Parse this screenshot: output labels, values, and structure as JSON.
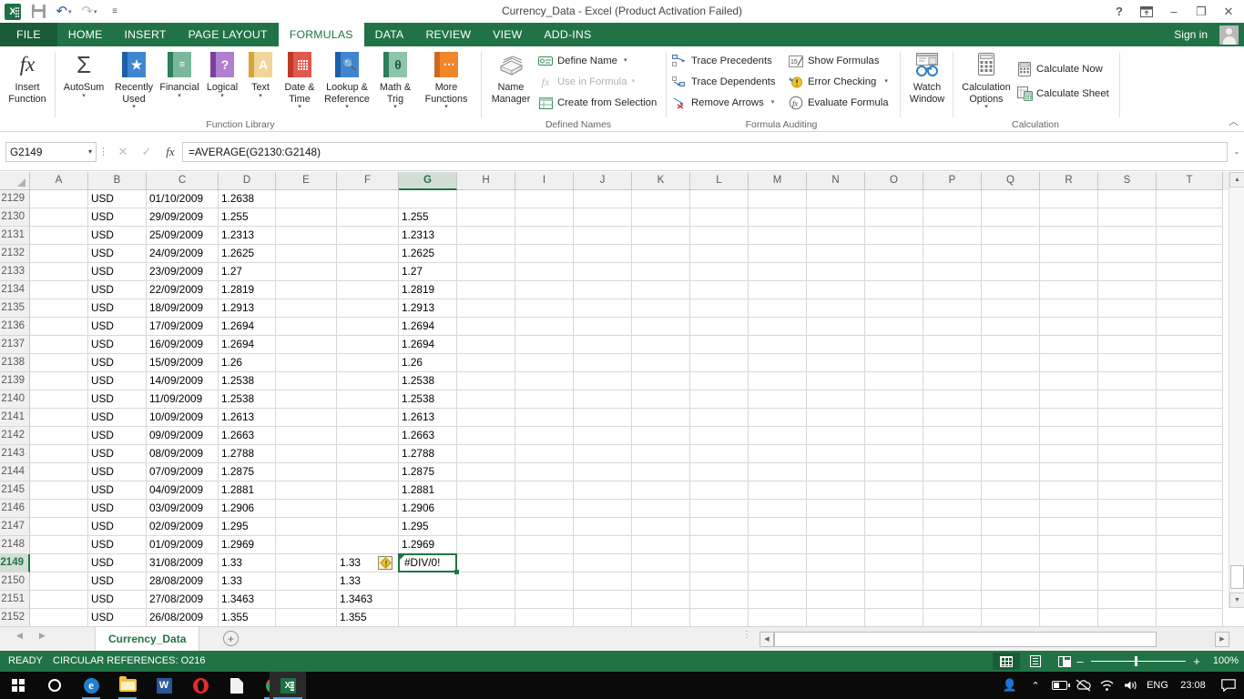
{
  "window": {
    "title": "Currency_Data - Excel (Product Activation Failed)",
    "quick_access": [
      {
        "name": "excel-logo",
        "label": "X"
      },
      {
        "name": "save-icon",
        "label": "Save"
      },
      {
        "name": "undo-icon",
        "label": "↶"
      },
      {
        "name": "redo-icon",
        "label": "↷"
      },
      {
        "name": "customize-qat-icon",
        "label": "⌄"
      }
    ],
    "controls": {
      "help": "?",
      "ribbon_display": "ribbon-display-options",
      "minimize": "–",
      "restore": "❐",
      "close": "✕"
    },
    "signin": "Sign in"
  },
  "ribbon": {
    "tabs": [
      {
        "label": "FILE",
        "active": false,
        "file": true
      },
      {
        "label": "HOME",
        "active": false
      },
      {
        "label": "INSERT",
        "active": false
      },
      {
        "label": "PAGE LAYOUT",
        "active": false
      },
      {
        "label": "FORMULAS",
        "active": true
      },
      {
        "label": "DATA",
        "active": false
      },
      {
        "label": "REVIEW",
        "active": false
      },
      {
        "label": "VIEW",
        "active": false
      },
      {
        "label": "ADD-INS",
        "active": false
      }
    ],
    "groups": [
      {
        "name": "function-library",
        "label": "Function Library",
        "buttons": [
          {
            "label": "Insert\nFunction",
            "icon": "fx-icon",
            "dropdown": false
          },
          {
            "label": "AutoSum",
            "icon": "sigma-icon",
            "dropdown": true
          },
          {
            "label": "Recently\nUsed",
            "icon": "star-book-icon",
            "dropdown": true
          },
          {
            "label": "Financial",
            "icon": "coins-book-icon",
            "dropdown": true
          },
          {
            "label": "Logical",
            "icon": "question-book-icon",
            "dropdown": true
          },
          {
            "label": "Text",
            "icon": "letter-a-book-icon",
            "dropdown": true
          },
          {
            "label": "Date &\nTime",
            "icon": "calendar-book-icon",
            "dropdown": true
          },
          {
            "label": "Lookup &\nReference",
            "icon": "magnifier-book-icon",
            "dropdown": true
          },
          {
            "label": "Math &\nTrig",
            "icon": "theta-book-icon",
            "dropdown": true
          },
          {
            "label": "More\nFunctions",
            "icon": "ellipsis-book-icon",
            "dropdown": true
          }
        ]
      },
      {
        "name": "defined-names",
        "label": "Defined Names",
        "big": {
          "label": "Name\nManager",
          "icon": "name-manager-icon"
        },
        "commands": [
          {
            "label": "Define Name",
            "icon": "define-name-icon",
            "dropdown": true,
            "disabled": false
          },
          {
            "label": "Use in Formula",
            "icon": "use-in-formula-icon",
            "dropdown": true,
            "disabled": true
          },
          {
            "label": "Create from Selection",
            "icon": "create-from-selection-icon",
            "dropdown": false,
            "disabled": false
          }
        ]
      },
      {
        "name": "formula-auditing",
        "label": "Formula Auditing",
        "col1": [
          {
            "label": "Trace Precedents",
            "icon": "trace-precedents-icon",
            "dropdown": false
          },
          {
            "label": "Trace Dependents",
            "icon": "trace-dependents-icon",
            "dropdown": false
          },
          {
            "label": "Remove Arrows",
            "icon": "remove-arrows-icon",
            "dropdown": true
          }
        ],
        "col2": [
          {
            "label": "Show Formulas",
            "icon": "show-formulas-icon",
            "dropdown": false
          },
          {
            "label": "Error Checking",
            "icon": "error-checking-icon",
            "dropdown": true
          },
          {
            "label": "Evaluate Formula",
            "icon": "evaluate-formula-icon",
            "dropdown": false
          }
        ],
        "watch": {
          "label": "Watch\nWindow",
          "icon": "watch-window-icon"
        }
      },
      {
        "name": "calculation",
        "label": "Calculation",
        "big": {
          "label": "Calculation\nOptions",
          "icon": "calculation-options-icon",
          "dropdown": true
        },
        "commands": [
          {
            "label": "Calculate Now",
            "icon": "calculate-now-icon"
          },
          {
            "label": "Calculate Sheet",
            "icon": "calculate-sheet-icon"
          }
        ]
      }
    ],
    "collapse": "collapse-ribbon-icon"
  },
  "formula_bar": {
    "name_box": "G2149",
    "cancel": "✕",
    "enter": "✓",
    "fx": "fx",
    "formula": "=AVERAGE(G2130:G2148)",
    "expand": "⌄"
  },
  "grid": {
    "columns": [
      "A",
      "B",
      "C",
      "D",
      "E",
      "F",
      "G",
      "H",
      "I",
      "J",
      "K",
      "L",
      "M",
      "N",
      "O",
      "P",
      "Q",
      "R",
      "S",
      "T"
    ],
    "selected_column": "G",
    "selected_row": "2149",
    "selected_cell": "G2149",
    "selected_value": "#DIV/0!",
    "rows": [
      {
        "n": "2129",
        "b": "USD",
        "c": "01/10/2009",
        "d": "1.2638",
        "f": "",
        "g": ""
      },
      {
        "n": "2130",
        "b": "USD",
        "c": "29/09/2009",
        "d": "1.255",
        "f": "",
        "g": "1.255"
      },
      {
        "n": "2131",
        "b": "USD",
        "c": "25/09/2009",
        "d": "1.2313",
        "f": "",
        "g": "1.2313"
      },
      {
        "n": "2132",
        "b": "USD",
        "c": "24/09/2009",
        "d": "1.2625",
        "f": "",
        "g": "1.2625"
      },
      {
        "n": "2133",
        "b": "USD",
        "c": "23/09/2009",
        "d": "1.27",
        "f": "",
        "g": "1.27"
      },
      {
        "n": "2134",
        "b": "USD",
        "c": "22/09/2009",
        "d": "1.2819",
        "f": "",
        "g": "1.2819"
      },
      {
        "n": "2135",
        "b": "USD",
        "c": "18/09/2009",
        "d": "1.2913",
        "f": "",
        "g": "1.2913"
      },
      {
        "n": "2136",
        "b": "USD",
        "c": "17/09/2009",
        "d": "1.2694",
        "f": "",
        "g": "1.2694"
      },
      {
        "n": "2137",
        "b": "USD",
        "c": "16/09/2009",
        "d": "1.2694",
        "f": "",
        "g": "1.2694"
      },
      {
        "n": "2138",
        "b": "USD",
        "c": "15/09/2009",
        "d": "1.26",
        "f": "",
        "g": "1.26"
      },
      {
        "n": "2139",
        "b": "USD",
        "c": "14/09/2009",
        "d": "1.2538",
        "f": "",
        "g": "1.2538"
      },
      {
        "n": "2140",
        "b": "USD",
        "c": "11/09/2009",
        "d": "1.2538",
        "f": "",
        "g": "1.2538"
      },
      {
        "n": "2141",
        "b": "USD",
        "c": "10/09/2009",
        "d": "1.2613",
        "f": "",
        "g": "1.2613"
      },
      {
        "n": "2142",
        "b": "USD",
        "c": "09/09/2009",
        "d": "1.2663",
        "f": "",
        "g": "1.2663"
      },
      {
        "n": "2143",
        "b": "USD",
        "c": "08/09/2009",
        "d": "1.2788",
        "f": "",
        "g": "1.2788"
      },
      {
        "n": "2144",
        "b": "USD",
        "c": "07/09/2009",
        "d": "1.2875",
        "f": "",
        "g": "1.2875"
      },
      {
        "n": "2145",
        "b": "USD",
        "c": "04/09/2009",
        "d": "1.2881",
        "f": "",
        "g": "1.2881"
      },
      {
        "n": "2146",
        "b": "USD",
        "c": "03/09/2009",
        "d": "1.2906",
        "f": "",
        "g": "1.2906"
      },
      {
        "n": "2147",
        "b": "USD",
        "c": "02/09/2009",
        "d": "1.295",
        "f": "",
        "g": "1.295"
      },
      {
        "n": "2148",
        "b": "USD",
        "c": "01/09/2009",
        "d": "1.2969",
        "f": "",
        "g": "1.2969"
      },
      {
        "n": "2149",
        "b": "USD",
        "c": "31/08/2009",
        "d": "1.33",
        "f": "1.33",
        "g": "#DIV/0!"
      },
      {
        "n": "2150",
        "b": "USD",
        "c": "28/08/2009",
        "d": "1.33",
        "f": "1.33",
        "g": ""
      },
      {
        "n": "2151",
        "b": "USD",
        "c": "27/08/2009",
        "d": "1.3463",
        "f": "1.3463",
        "g": ""
      },
      {
        "n": "2152",
        "b": "USD",
        "c": "26/08/2009",
        "d": "1.355",
        "f": "1.355",
        "g": ""
      }
    ],
    "error_flag": "error-indicator-icon"
  },
  "sheet_bar": {
    "prev": "◀",
    "next": "▶",
    "tabs": [
      {
        "label": "Currency_Data",
        "active": true
      }
    ],
    "add_sheet": "+"
  },
  "status_bar": {
    "mode": "READY",
    "circular": "CIRCULAR REFERENCES: O216",
    "views": [
      {
        "name": "normal-view-button",
        "active": true
      },
      {
        "name": "page-layout-view-button",
        "active": false
      },
      {
        "name": "page-break-preview-button",
        "active": false
      }
    ],
    "zoom_out": "–",
    "zoom_in": "+",
    "zoom_level": "100%"
  },
  "taskbar": {
    "items": [
      {
        "name": "start-button",
        "icon": "windows-flag-icon"
      },
      {
        "name": "cortana-button",
        "icon": "cortana-circle-icon"
      },
      {
        "name": "edge-button",
        "icon": "edge-icon"
      },
      {
        "name": "file-explorer-button",
        "icon": "folder-icon"
      },
      {
        "name": "word-button",
        "icon": "word-icon"
      },
      {
        "name": "opera-button",
        "icon": "opera-icon"
      },
      {
        "name": "document-button",
        "icon": "document-icon"
      },
      {
        "name": "chrome-button",
        "icon": "chrome-icon"
      },
      {
        "name": "excel-taskbar-button",
        "icon": "excel-icon"
      }
    ],
    "tray": {
      "people": "people-icon",
      "chevron": "show-hidden-icons-icon",
      "battery": "battery-icon",
      "onedrive": "onedrive-icon",
      "wifi": "wifi-icon",
      "volume": "volume-icon",
      "language": "ENG",
      "clock": "23:08",
      "action_center": "action-center-icon"
    }
  }
}
